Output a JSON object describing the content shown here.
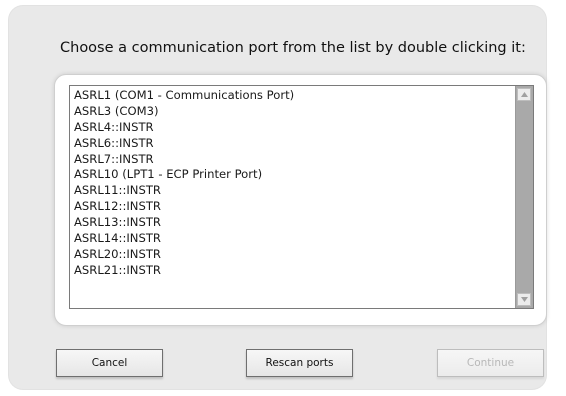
{
  "dialog": {
    "prompt": "Choose a communication port from the list by double clicking it:"
  },
  "ports": [
    "ASRL1  (COM1 - Communications Port)",
    "ASRL3  (COM3)",
    "ASRL4::INSTR",
    "ASRL6::INSTR",
    "ASRL7::INSTR",
    "ASRL10  (LPT1 - ECP Printer Port)",
    "ASRL11::INSTR",
    "ASRL12::INSTR",
    "ASRL13::INSTR",
    "ASRL14::INSTR",
    "ASRL20::INSTR",
    "ASRL21::INSTR"
  ],
  "buttons": {
    "cancel": "Cancel",
    "rescan": "Rescan ports",
    "continue": "Continue"
  },
  "icons": {
    "scroll_up": "scroll-up-arrow-icon",
    "scroll_down": "scroll-down-arrow-icon"
  }
}
